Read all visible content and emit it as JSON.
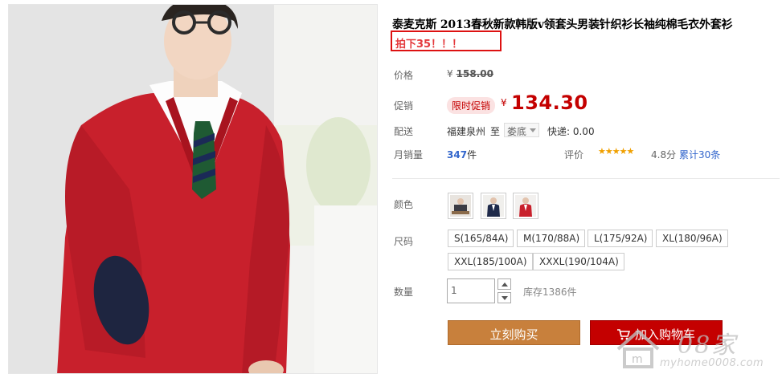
{
  "product": {
    "title": "泰麦克斯 2013春秋新款韩版v领套头男装针织衫长袖纯棉毛衣外套衫",
    "promo_note": "拍下35！！！"
  },
  "price": {
    "label": "价格",
    "original_currency": "¥",
    "original_value": "158.00"
  },
  "promotion": {
    "label": "促销",
    "badge": "限时促销",
    "currency": "¥",
    "value": "134.30"
  },
  "shipping": {
    "label": "配送",
    "from": "福建泉州",
    "to_label": "至",
    "destination": "娄底",
    "cost": "快递: 0.00"
  },
  "sales": {
    "label": "月销量",
    "count": "347",
    "unit": "件"
  },
  "rating": {
    "label": "评价",
    "stars": "★★★★★",
    "score": "4.8分",
    "reviews": "累计30条",
    "star_color": "#f0a000"
  },
  "color": {
    "label": "颜色",
    "swatches": [
      "swatch-sitting",
      "swatch-navy",
      "swatch-red"
    ]
  },
  "size": {
    "label": "尺码",
    "options": [
      "S(165/84A)",
      "M(170/88A)",
      "L(175/92A)",
      "XL(180/96A)",
      "XXL(185/100A)",
      "XXXL(190/104A)"
    ]
  },
  "quantity": {
    "label": "数量",
    "value": "1",
    "stock": "库存1386件"
  },
  "actions": {
    "buy_now": "立刻购买",
    "add_to_cart": "加入购物车",
    "buy_color": "#c8803c",
    "cart_color": "#c40000"
  },
  "watermark": {
    "brand": "08家",
    "url": "myhome0008.com"
  }
}
